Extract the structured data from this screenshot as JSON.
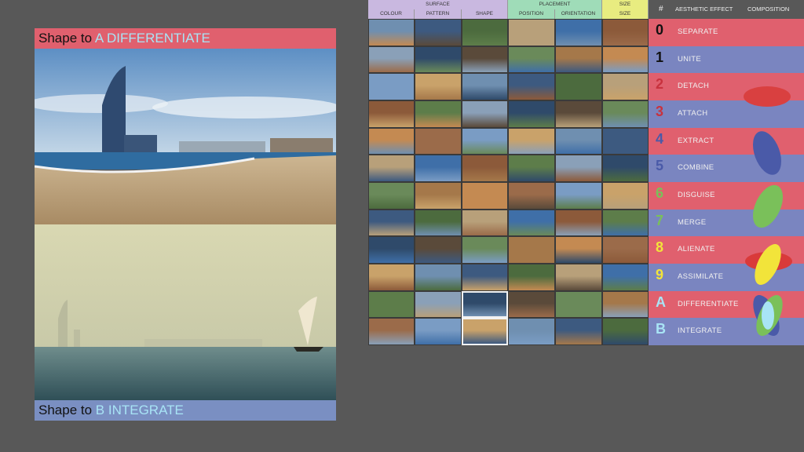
{
  "poster": {
    "top_prefix": "Shape to",
    "top_keyword": "A DIFFERENTIATE",
    "bottom_prefix": "Shape to",
    "bottom_keyword": "B INTEGRATE"
  },
  "grid": {
    "groups": [
      "SURFACE",
      "PLACEMENT",
      "SIZE"
    ],
    "columns": [
      "COLOUR",
      "PATTERN",
      "SHAPE",
      "POSITION",
      "ORIENTATION",
      "SIZE"
    ]
  },
  "legend": {
    "hash": "#",
    "aesthetic_effect": "AESTHETIC EFFECT",
    "composition": "COMPOSITION",
    "rows": [
      {
        "num": "0",
        "effect": "SEPARATE",
        "num_color": "#111111",
        "row_color": "#e0606e"
      },
      {
        "num": "1",
        "effect": "UNITE",
        "num_color": "#111111",
        "row_color": "#7a85c0"
      },
      {
        "num": "2",
        "effect": "DETACH",
        "num_color": "#c8323e",
        "row_color": "#e0606e"
      },
      {
        "num": "3",
        "effect": "ATTACH",
        "num_color": "#c8323e",
        "row_color": "#7a85c0"
      },
      {
        "num": "4",
        "effect": "EXTRACT",
        "num_color": "#4a5aa8",
        "row_color": "#e0606e"
      },
      {
        "num": "5",
        "effect": "COMBINE",
        "num_color": "#4a5aa8",
        "row_color": "#7a85c0"
      },
      {
        "num": "6",
        "effect": "DISGUISE",
        "num_color": "#7ac05a",
        "row_color": "#e0606e"
      },
      {
        "num": "7",
        "effect": "MERGE",
        "num_color": "#7ac05a",
        "row_color": "#7a85c0"
      },
      {
        "num": "8",
        "effect": "ALIENATE",
        "num_color": "#f2e43a",
        "row_color": "#e0606e"
      },
      {
        "num": "9",
        "effect": "ASSIMILATE",
        "num_color": "#f2e43a",
        "row_color": "#7a85c0"
      },
      {
        "num": "A",
        "effect": "DIFFERENTIATE",
        "num_color": "#a8e4f5",
        "row_color": "#e0606e"
      },
      {
        "num": "B",
        "effect": "INTEGRATE",
        "num_color": "#a8e4f5",
        "row_color": "#7a85c0"
      }
    ]
  },
  "colors": {
    "background": "#585858",
    "red": "#e0606e",
    "blue": "#7a85c0",
    "surface_header": "#c9b8e0",
    "placement_header": "#9fdcb8",
    "size_header": "#e8ec80",
    "differentiate": "#a8e4f5"
  }
}
